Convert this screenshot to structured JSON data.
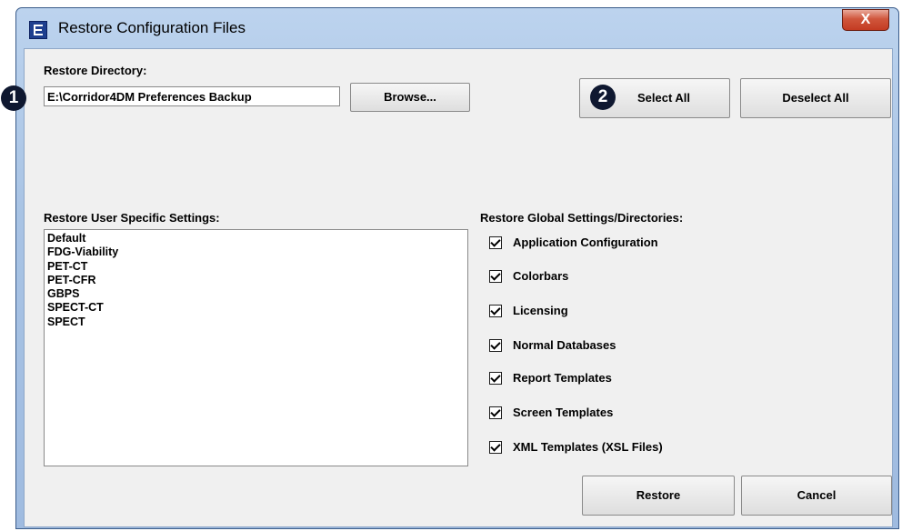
{
  "window": {
    "title": "Restore Configuration Files",
    "close_label": "X"
  },
  "directory": {
    "label": "Restore Directory:",
    "value": "E:\\Corridor4DM Preferences Backup",
    "browse_label": "Browse..."
  },
  "selection": {
    "select_all_label": "Select All",
    "deselect_all_label": "Deselect All"
  },
  "user_settings": {
    "label": "Restore User Specific Settings:",
    "items": [
      "Default",
      "FDG-Viability",
      "PET-CT",
      "PET-CFR",
      "GBPS",
      "SPECT-CT",
      "SPECT"
    ]
  },
  "global_settings": {
    "label": "Restore Global Settings/Directories:",
    "items": [
      {
        "label": "Application Configuration",
        "checked": true
      },
      {
        "label": "Colorbars",
        "checked": true
      },
      {
        "label": "Licensing",
        "checked": true
      },
      {
        "label": "Normal Databases",
        "checked": true
      },
      {
        "label": "Report Templates",
        "checked": true
      },
      {
        "label": "Screen Templates",
        "checked": true
      },
      {
        "label": "XML Templates (XSL Files)",
        "checked": true
      }
    ]
  },
  "actions": {
    "restore_label": "Restore",
    "cancel_label": "Cancel"
  },
  "annotations": {
    "badge_1": "1",
    "badge_2": "2"
  }
}
